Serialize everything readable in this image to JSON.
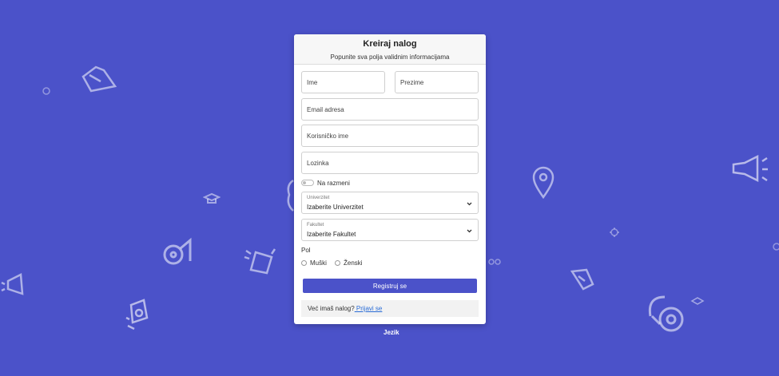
{
  "form": {
    "title": "Kreiraj nalog",
    "subtitle": "Popunite sva polja validnim informacijama",
    "first_name_placeholder": "Ime",
    "last_name_placeholder": "Prezime",
    "email_placeholder": "Email adresa",
    "username_placeholder": "Korisničko ime",
    "password_placeholder": "Lozinka",
    "exchange_toggle_label": "Na razmeni",
    "exchange_toggle_on": false,
    "university": {
      "label": "Univerzitet",
      "value": "Izaberite Univerzitet"
    },
    "faculty": {
      "label": "Fakultet",
      "value": "Izaberite Fakultet"
    },
    "gender_label": "Pol",
    "gender_options": [
      "Muški",
      "Ženski"
    ],
    "submit_label": "Registruj se",
    "login_prompt": "Već imaš nalog?",
    "login_link": " Prijavi se"
  },
  "footer": {
    "language_label": "Jezik"
  },
  "colors": {
    "background": "#4b52c9",
    "accent": "#4b52c9",
    "link": "#2a6cd6"
  }
}
